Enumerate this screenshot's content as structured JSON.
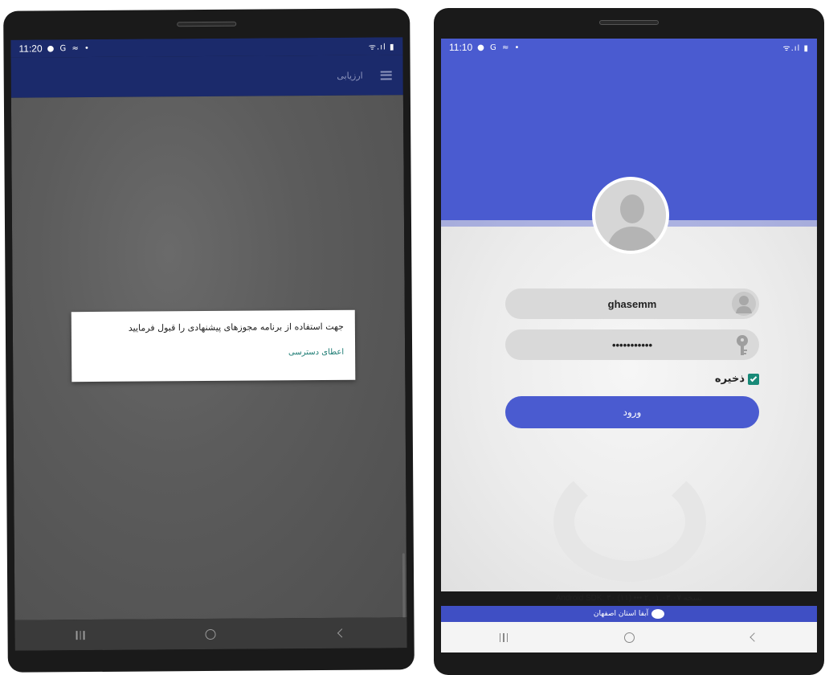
{
  "left_device": {
    "statusbar": {
      "time": "11:20",
      "sys_icons": "● G ≈ •",
      "right_icons": "ᯤ.ıl ▮"
    },
    "appbar": {
      "title": "ارزیابی"
    },
    "dialog": {
      "message": "جهت استفاده از برنامه مجوزهای پیشنهادی را قبول فرمایید",
      "action_label": "اعطای دسترسی"
    }
  },
  "right_device": {
    "statusbar": {
      "time": "11:10",
      "sys_icons": "● G ≈ •",
      "right_icons": "ᯤ.ıl ▮"
    },
    "login": {
      "username_value": "ghasemm",
      "password_mask": "•••••••••••",
      "remember_label": "ذخیره",
      "remember_checked": true,
      "login_button_label": "ورود"
    },
    "version_text": "Android SDK: ۳۰ (۱۱) ••• ۲.۰۱.۰۳.۰۷ نسخه",
    "footer_text": "آبفا استان اصفهان"
  },
  "colors": {
    "appbar": "#1b2a6b",
    "primary": "#4a5bd0",
    "checkbox": "#188a78",
    "dialog_action": "#1a7a72"
  },
  "icons": [
    "menu-icon",
    "recents-icon",
    "home-icon",
    "back-icon",
    "user-silhouette-icon",
    "key-icon",
    "checkbox-icon",
    "logo-icon"
  ]
}
